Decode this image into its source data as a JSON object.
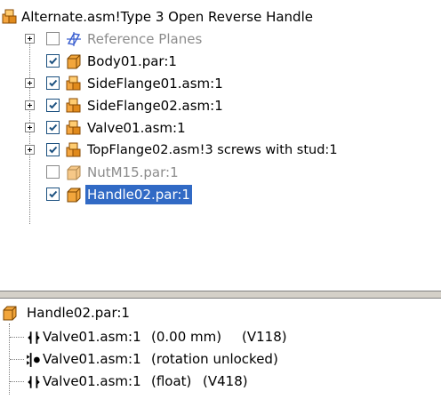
{
  "tree": {
    "root": {
      "label": "Alternate.asm!Type 3 Open Reverse Handle",
      "icon": "assembly-icon"
    },
    "items": [
      {
        "label": "Reference Planes",
        "icon": "reference-planes-icon",
        "checked": false,
        "expandable": true,
        "dimmed": true
      },
      {
        "label": "Body01.par:1",
        "icon": "part-icon",
        "checked": true,
        "expandable": false,
        "dimmed": false
      },
      {
        "label": "SideFlange01.asm:1",
        "icon": "assembly-icon",
        "checked": true,
        "expandable": true,
        "dimmed": false
      },
      {
        "label": "SideFlange02.asm:1",
        "icon": "assembly-icon",
        "checked": true,
        "expandable": true,
        "dimmed": false
      },
      {
        "label": "Valve01.asm:1",
        "icon": "assembly-icon",
        "checked": true,
        "expandable": true,
        "dimmed": false
      },
      {
        "label": "TopFlange02.asm!3 screws with stud:1",
        "icon": "assembly-icon",
        "checked": true,
        "expandable": true,
        "dimmed": false
      },
      {
        "label": "NutM15.par:1",
        "icon": "part-icon",
        "checked": false,
        "expandable": false,
        "dimmed": true
      },
      {
        "label": "Handle02.par:1",
        "icon": "part-icon",
        "checked": true,
        "expandable": false,
        "dimmed": false,
        "selected": true
      }
    ]
  },
  "details": {
    "title": "Handle02.par:1",
    "relationships": [
      {
        "icon": "mate-relationship-icon",
        "target": "Valve01.asm:1",
        "detail": "(0.00 mm)",
        "version": "(V118)"
      },
      {
        "icon": "axial-align-relationship-icon",
        "target": "Valve01.asm:1",
        "detail": "(rotation unlocked)",
        "version": ""
      },
      {
        "icon": "mate-relationship-icon",
        "target": "Valve01.asm:1",
        "detail": "(float)",
        "version": "(V418)"
      }
    ]
  },
  "colors": {
    "selection": "#316ac5",
    "assembly_icon": "#d4780f",
    "part_icon": "#f0a030",
    "check": "#1c5180",
    "splitter": "#d4d0c8"
  }
}
